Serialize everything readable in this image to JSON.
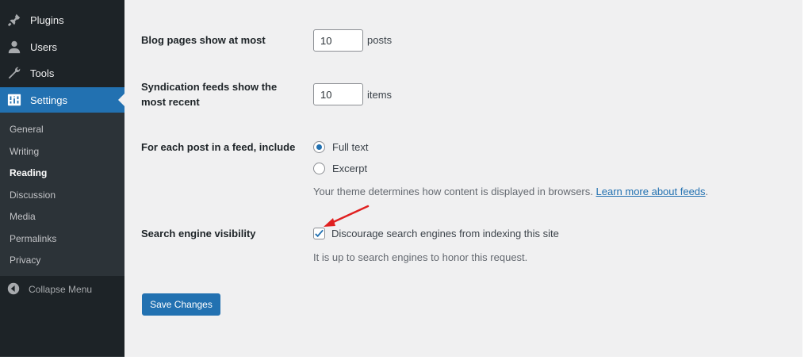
{
  "sidebar": {
    "items": [
      {
        "label": "Plugins",
        "icon": "plugin-icon"
      },
      {
        "label": "Users",
        "icon": "users-icon"
      },
      {
        "label": "Tools",
        "icon": "tools-icon"
      },
      {
        "label": "Settings",
        "icon": "settings-icon",
        "current": true
      }
    ],
    "submenu": [
      {
        "label": "General"
      },
      {
        "label": "Writing"
      },
      {
        "label": "Reading",
        "current": true
      },
      {
        "label": "Discussion"
      },
      {
        "label": "Media"
      },
      {
        "label": "Permalinks"
      },
      {
        "label": "Privacy"
      }
    ],
    "collapse_label": "Collapse Menu"
  },
  "settings": {
    "blog_pages": {
      "label": "Blog pages show at most",
      "value": "10",
      "suffix": "posts"
    },
    "syndication": {
      "label_line1": "Syndication feeds show the",
      "label_line2": "most recent",
      "value": "10",
      "suffix": "items"
    },
    "feed_include": {
      "label": "For each post in a feed, include",
      "options": [
        {
          "label": "Full text",
          "selected": true
        },
        {
          "label": "Excerpt",
          "selected": false
        }
      ],
      "description": "Your theme determines how content is displayed in browsers.",
      "link_text": "Learn more about feeds",
      "link_suffix": "."
    },
    "search_visibility": {
      "label": "Search engine visibility",
      "checkbox_label": "Discourage search engines from indexing this site",
      "checked": true,
      "description": "It is up to search engines to honor this request."
    }
  },
  "save_label": "Save Changes",
  "colors": {
    "accent": "#2271b1",
    "sidebar_bg": "#1d2327",
    "submenu_bg": "#2c3338",
    "main_bg": "#f0f0f1",
    "annotation_arrow": "#e02020"
  }
}
